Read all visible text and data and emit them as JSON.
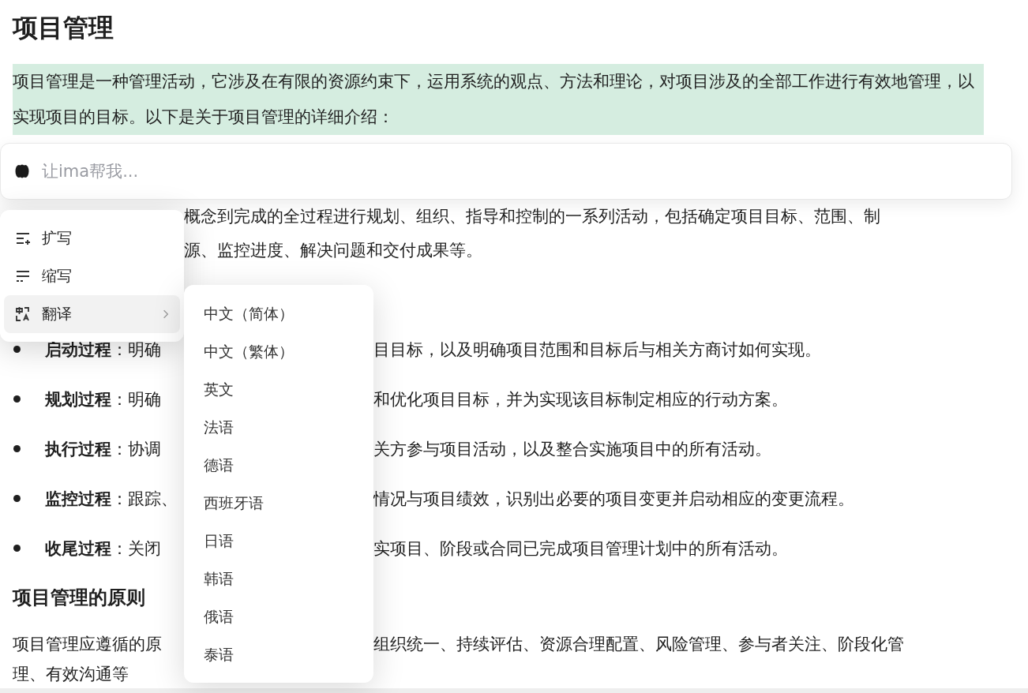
{
  "title": "项目管理",
  "intro": {
    "text": "项目管理是一种管理活动，它涉及在有限的资源约束下，运用系统的观点、方法和理论，对项目涉及的全部工作进行有效地管理，以实现项目的目标。以下是关于项目管理的详细介绍：",
    "highlighted": true
  },
  "ai_bar": {
    "placeholder": "让ima帮我..."
  },
  "paragraph": [
    "概念到完成的全过程进行规划、组织、指导和控制的一系列活动，包括确定项目目标、范围、制",
    "源、监控进度、解决问题和交付成果等。"
  ],
  "steps": [
    {
      "label": "启动过程",
      "before": "：明确",
      "after": "目目标，以及明确项目范围和目标后与相关方商讨如何实现。"
    },
    {
      "label": "规划过程",
      "before": "：明确",
      "after": "和优化项目目标，并为实现该目标制定相应的行动方案。"
    },
    {
      "label": "执行过程",
      "before": "：协调",
      "after": "关方参与项目活动，以及整合实施项目中的所有活动。"
    },
    {
      "label": "监控过程",
      "before": "：跟踪、",
      "after": "情况与项目绩效，识别出必要的项目变更并启动相应的变更流程。"
    },
    {
      "label": "收尾过程",
      "before": "：关闭",
      "after": "实项目、阶段或合同已完成项目管理计划中的所有活动。"
    }
  ],
  "principles": {
    "heading": "项目管理的原则",
    "before": "项目管理应遵循的原",
    "after": "组织统一、持续评估、资源合理配置、风险管理、参与者关注、阶段化管",
    "last_line": "理、有效沟通等"
  },
  "menu": [
    {
      "label": "扩写",
      "kind": "expand",
      "selected": false,
      "has_submenu": false
    },
    {
      "label": "缩写",
      "kind": "shorten",
      "selected": false,
      "has_submenu": false
    },
    {
      "label": "翻译",
      "kind": "translate",
      "selected": true,
      "has_submenu": true
    }
  ],
  "languages": [
    "中文（简体）",
    "中文（繁体）",
    "英文",
    "法语",
    "德语",
    "西班牙语",
    "日语",
    "韩语",
    "俄语",
    "泰语"
  ]
}
